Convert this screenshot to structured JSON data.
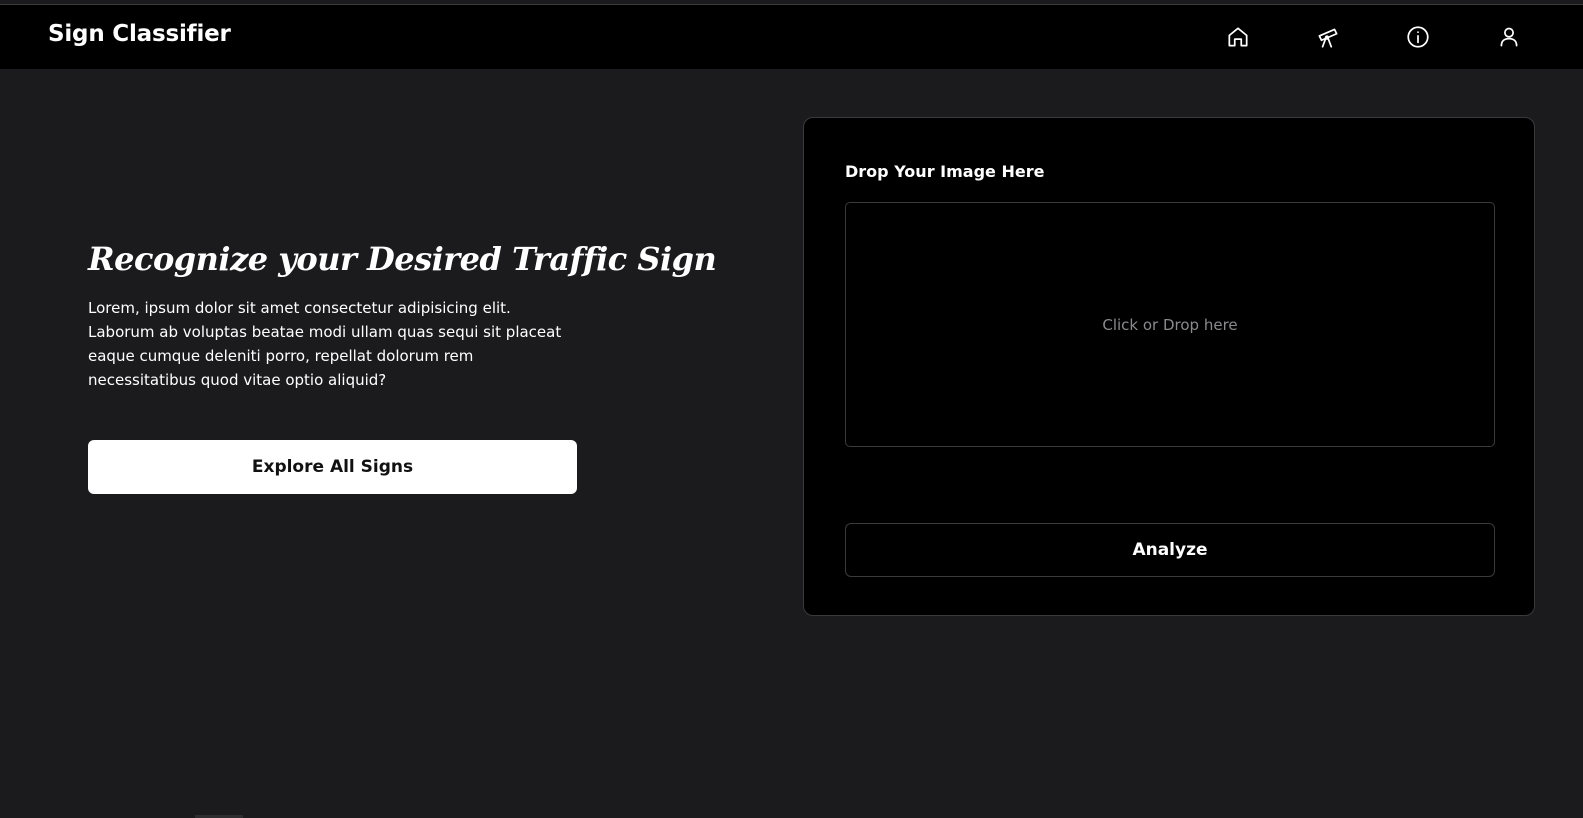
{
  "navbar": {
    "brand": "Sign Classifier",
    "icons": [
      "home-icon",
      "telescope-icon",
      "info-icon",
      "user-icon"
    ]
  },
  "hero": {
    "title": "Recognize your Desired Traffic Sign",
    "description": "Lorem, ipsum dolor sit amet consectetur adipisicing elit. Laborum ab voluptas beatae modi ullam quas sequi sit placeat eaque cumque deleniti porro, repellat dolorum rem necessitatibus quod vitae optio aliquid?",
    "explore_label": "Explore All Signs"
  },
  "upload": {
    "label": "Drop Your Image Here",
    "dropzone_text": "Click or Drop here",
    "analyze_label": "Analyze"
  },
  "colors": {
    "background": "#1b1b1d",
    "navbar": "#000000",
    "panel": "#000000",
    "border": "#3a3a3c",
    "muted_text": "#8a8a8e",
    "primary_button": "#ffffff"
  }
}
